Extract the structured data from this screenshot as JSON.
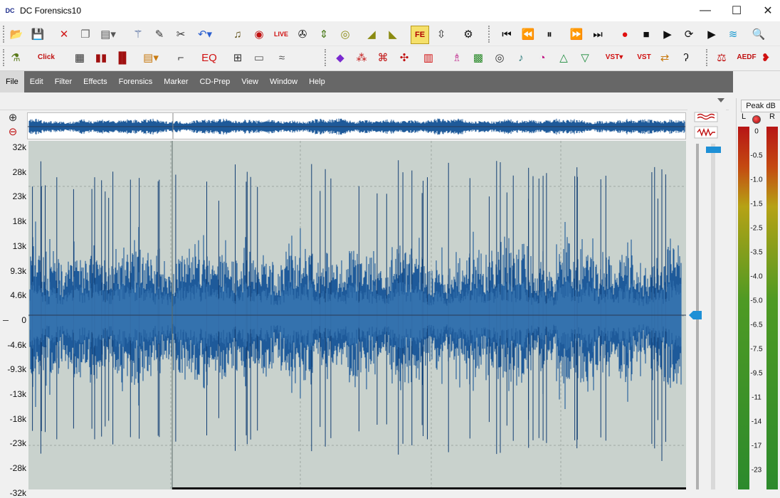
{
  "window": {
    "title": "DC Forensics10",
    "logo_text": "DC",
    "controls": {
      "minimize": "—",
      "maximize": "☐",
      "close": "✕"
    }
  },
  "toolbar1": {
    "buttons": [
      {
        "name": "open-folder-icon",
        "glyph": "📂",
        "color": "#c8961a"
      },
      {
        "name": "save-icon",
        "glyph": "💾",
        "color": "#1a4fa0"
      },
      {
        "name": "delete-icon",
        "glyph": "✕",
        "color": "#d01a1a"
      },
      {
        "name": "copy-icon",
        "glyph": "❐",
        "color": "#666666"
      },
      {
        "name": "paste-icon",
        "glyph": "▤▾",
        "color": "#555555"
      },
      {
        "name": "wand-icon",
        "glyph": "⚚",
        "color": "#2a4a8a"
      },
      {
        "name": "pencil-icon",
        "glyph": "✎",
        "color": "#333333"
      },
      {
        "name": "cut-icon",
        "glyph": "✂",
        "color": "#333333"
      },
      {
        "name": "undo-icon",
        "glyph": "↶▾",
        "color": "#2a5fd0"
      },
      {
        "name": "music-note-icon",
        "glyph": "♫",
        "color": "#5a4a10"
      },
      {
        "name": "record-disc-icon",
        "glyph": "◉",
        "color": "#c01010"
      },
      {
        "name": "live-icon",
        "glyph": "LIVE",
        "color": "#d01010"
      },
      {
        "name": "spinner-icon",
        "glyph": "✇",
        "color": "#111111"
      },
      {
        "name": "level-icon",
        "glyph": "⇕",
        "color": "#4a7a1a"
      },
      {
        "name": "knob-icon",
        "glyph": "◎",
        "color": "#8a8a10"
      },
      {
        "name": "ramp-up-icon",
        "glyph": "◢",
        "color": "#8a8a10"
      },
      {
        "name": "ramp-down-icon",
        "glyph": "◣",
        "color": "#8a8a10"
      },
      {
        "name": "fe-icon",
        "glyph": "FE",
        "color": "#b00000"
      },
      {
        "name": "splitter-icon",
        "glyph": "⇳",
        "color": "#333333"
      },
      {
        "name": "settings-gear-icon",
        "glyph": "⚙",
        "color": "#111111"
      }
    ],
    "transport": [
      {
        "name": "skip-start-icon",
        "glyph": "⏮",
        "color": "#111111"
      },
      {
        "name": "rewind-icon",
        "glyph": "⏪",
        "color": "#111111"
      },
      {
        "name": "pause-icon",
        "glyph": "⏸",
        "color": "#111111"
      },
      {
        "name": "fast-forward-icon",
        "glyph": "⏩",
        "color": "#111111"
      },
      {
        "name": "skip-end-icon",
        "glyph": "⏭",
        "color": "#111111"
      },
      {
        "name": "record-icon",
        "glyph": "●",
        "color": "#e01010"
      },
      {
        "name": "stop-icon",
        "glyph": "■",
        "color": "#111111"
      },
      {
        "name": "play-icon",
        "glyph": "▶",
        "color": "#111111"
      },
      {
        "name": "loop-icon",
        "glyph": "⟳",
        "color": "#111111"
      },
      {
        "name": "play-selection-icon",
        "glyph": "▶",
        "color": "#111111"
      },
      {
        "name": "waves-icon",
        "glyph": "≋",
        "color": "#1a9ad0"
      },
      {
        "name": "zoom-search-icon",
        "glyph": "🔍",
        "color": "#333333"
      }
    ]
  },
  "toolbar2": {
    "buttons": [
      {
        "name": "filter-icon",
        "glyph": "⚗",
        "color": "#5a7a1a"
      },
      {
        "name": "click-filter-icon",
        "glyph": "Click",
        "color": "#c01010"
      },
      {
        "name": "spectrum-icon",
        "glyph": "▦",
        "color": "#333333"
      },
      {
        "name": "bars-icon",
        "glyph": "▮▮",
        "color": "#a01010"
      },
      {
        "name": "histogram-icon",
        "glyph": "▐▌",
        "color": "#a01010"
      },
      {
        "name": "doc-icon",
        "glyph": "▤▾",
        "color": "#c87a10"
      },
      {
        "name": "chart-icon",
        "glyph": "⌐",
        "color": "#333333"
      },
      {
        "name": "eq-icon",
        "glyph": "EQ",
        "color": "#d01010"
      },
      {
        "name": "nodes-icon",
        "glyph": "⊞",
        "color": "#333333"
      },
      {
        "name": "bank-icon",
        "glyph": "▭",
        "color": "#555555"
      },
      {
        "name": "wind-icon",
        "glyph": "≈",
        "color": "#555555"
      },
      {
        "name": "diamond-icon",
        "glyph": "◆",
        "color": "#7a2ad0"
      },
      {
        "name": "x-pattern-icon",
        "glyph": "⁂",
        "color": "#c01010"
      },
      {
        "name": "pattern-icon",
        "glyph": "⌘",
        "color": "#c01010"
      },
      {
        "name": "sparkle-icon",
        "glyph": "✣",
        "color": "#c01010"
      },
      {
        "name": "comb-icon",
        "glyph": "▥",
        "color": "#d01010"
      },
      {
        "name": "person-icon",
        "glyph": "♗",
        "color": "#c03090"
      },
      {
        "name": "image-icon",
        "glyph": "▩",
        "color": "#2a8a2a"
      },
      {
        "name": "dial-icon",
        "glyph": "◎",
        "color": "#333333"
      },
      {
        "name": "bell-icon",
        "glyph": "♪",
        "color": "#2a7a7a"
      },
      {
        "name": "pie-icon",
        "glyph": "◔",
        "color": "#c01080"
      },
      {
        "name": "triangle-icon",
        "glyph": "△",
        "color": "#1a8a3a"
      },
      {
        "name": "funnel-icon",
        "glyph": "▽",
        "color": "#1a8a3a"
      },
      {
        "name": "vst-icon",
        "glyph": "VST▾",
        "color": "#d01010"
      },
      {
        "name": "vst-wave-icon",
        "glyph": "VST",
        "color": "#d01010"
      },
      {
        "name": "swap-arrows-icon",
        "glyph": "⇄",
        "color": "#c87a10"
      },
      {
        "name": "ear-icon",
        "glyph": "ʔ",
        "color": "#111111"
      },
      {
        "name": "scales-icon",
        "glyph": "⚖",
        "color": "#c01010"
      },
      {
        "name": "aedf-icon",
        "glyph": "AEDF",
        "color": "#c01010"
      },
      {
        "name": "lips-icon",
        "glyph": "❥",
        "color": "#d01010"
      }
    ]
  },
  "menu": [
    "File",
    "Edit",
    "Filter",
    "Effects",
    "Forensics",
    "Marker",
    "CD-Prep",
    "View",
    "Window",
    "Help"
  ],
  "ruler_labels": [
    "32k",
    "28k",
    "23k",
    "18k",
    "13k",
    "9.3k",
    "4.6k",
    "0",
    "-4.6k",
    "-9.3k",
    "-13k",
    "-18k",
    "-23k",
    "-28k",
    "-32k"
  ],
  "meter": {
    "title": "Peak dB",
    "left_label": "L",
    "right_label": "R",
    "scale": [
      "0",
      "-0.5",
      "-1.0",
      "-1.5",
      "-2.5",
      "-3.5",
      "-4.0",
      "-5.0",
      "-6.5",
      "-7.5",
      "-9.5",
      "-11",
      "-14",
      "-17",
      "-23"
    ]
  },
  "colors": {
    "waveform_bg": "#c9d2cd",
    "waveform_fill": "#1e5a9a",
    "waveform_dark": "#123e73",
    "waveform_center": "#3a78b4",
    "menubar_bg": "#676767",
    "accent": "#1e90d6"
  }
}
